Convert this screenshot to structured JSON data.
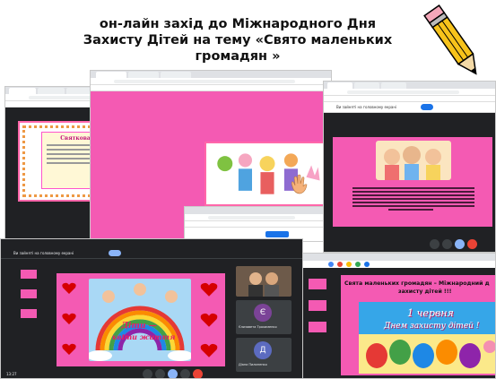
{
  "headline": {
    "line1": "он-лайн захід до Міжнародного Дня",
    "line2": "Захисту Дітей на тему «Свято маленьких",
    "line3": "громадян »"
  },
  "windows": {
    "top_left": {
      "slide_title": "Святкова свята"
    },
    "top_right": {
      "meet_label": "Ви зайняті на головному екрані"
    },
    "bottom_left": {
      "meet_label": "Ви зайняті на головному екрані",
      "rainbow_text_1": "Діти —",
      "rainbow_text_2": "квіти життя",
      "participant_1_initial": "Є",
      "participant_1_name": "Єлизавета Трохименко",
      "participant_2_initial": "Д",
      "participant_2_name": "Діана Пилипенко",
      "time": "13:27"
    },
    "bottom_right": {
      "slide_title_1": "Свята маленьких громадян – Міжнародний д",
      "slide_title_2": "захисту дітей !!!",
      "banner_line1": "1 червня",
      "banner_line2": "Днем захисту дітей !"
    }
  },
  "colors": {
    "pink": "#f45ab3",
    "meet_dark": "#202124",
    "rainbow_bg": "#a9d8f5"
  }
}
